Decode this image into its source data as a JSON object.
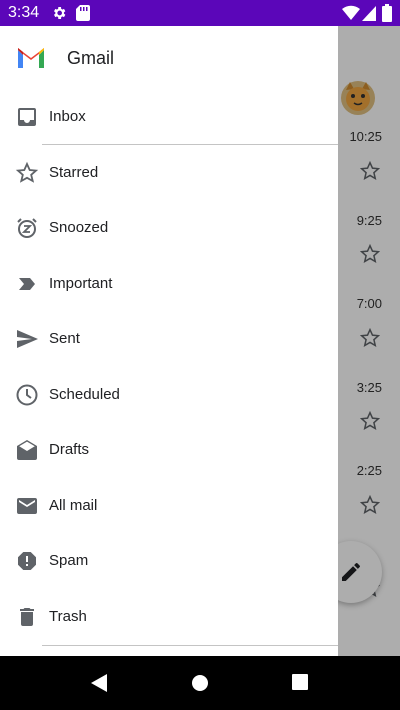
{
  "status_bar": {
    "time": "3:34"
  },
  "drawer": {
    "app_name": "Gmail",
    "items": [
      {
        "label": "Inbox",
        "icon": "inbox-icon"
      },
      {
        "label": "Starred",
        "icon": "star-outline-icon"
      },
      {
        "label": "Snoozed",
        "icon": "snooze-icon"
      },
      {
        "label": "Important",
        "icon": "important-icon"
      },
      {
        "label": "Sent",
        "icon": "send-icon"
      },
      {
        "label": "Scheduled",
        "icon": "clock-icon"
      },
      {
        "label": "Drafts",
        "icon": "drafts-icon"
      },
      {
        "label": "All mail",
        "icon": "mail-icon"
      },
      {
        "label": "Spam",
        "icon": "spam-icon"
      },
      {
        "label": "Trash",
        "icon": "trash-icon"
      }
    ]
  },
  "background_list": {
    "times": [
      "10:25",
      "9:25",
      "7:00",
      "3:25",
      "2:25"
    ]
  },
  "colors": {
    "status_bar": "#5b06b9",
    "icon_gray": "#5f6368"
  }
}
